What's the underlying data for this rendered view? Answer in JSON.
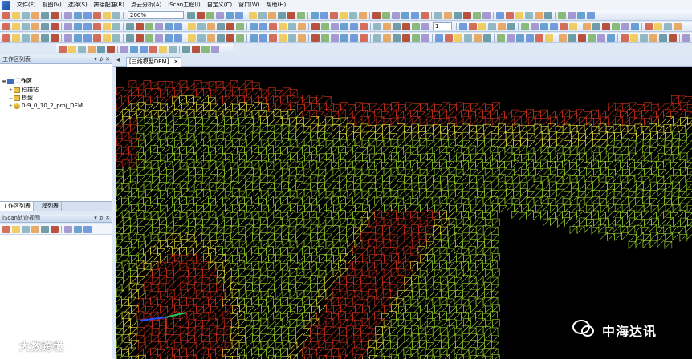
{
  "menu": {
    "items": [
      "文件(F)",
      "视图(V)",
      "选择(S)",
      "拼接配准(R)",
      "点云分析(A)",
      "iScan工程(I)",
      "自定义(C)",
      "窗口(W)",
      "帮助(H)"
    ]
  },
  "toolbar": {
    "zoom_value": "200%",
    "number_value": "1"
  },
  "workspace_panel": {
    "title": "工作区列表",
    "controls": "▾ ⊅ ✕",
    "tree": {
      "root": "工作区",
      "scan_station": "扫描站",
      "model": "模型",
      "model_item": "0-9_0_10_2_proj_DEM"
    }
  },
  "bottom_tabs": [
    "工作区列表",
    "工程列表"
  ],
  "track_panel": {
    "title": "iScan轨迹视图",
    "controls": "▾ ⊅ ✕"
  },
  "document": {
    "tab_label": "[三维模型DEM]",
    "close_label": "✕"
  },
  "mesh_colors": {
    "green": "#9bd42b",
    "yellow": "#e8e23a",
    "red": "#d0331a",
    "background": "#000000"
  },
  "watermarks": {
    "left": "大数跨境",
    "right": "中海达讯"
  }
}
